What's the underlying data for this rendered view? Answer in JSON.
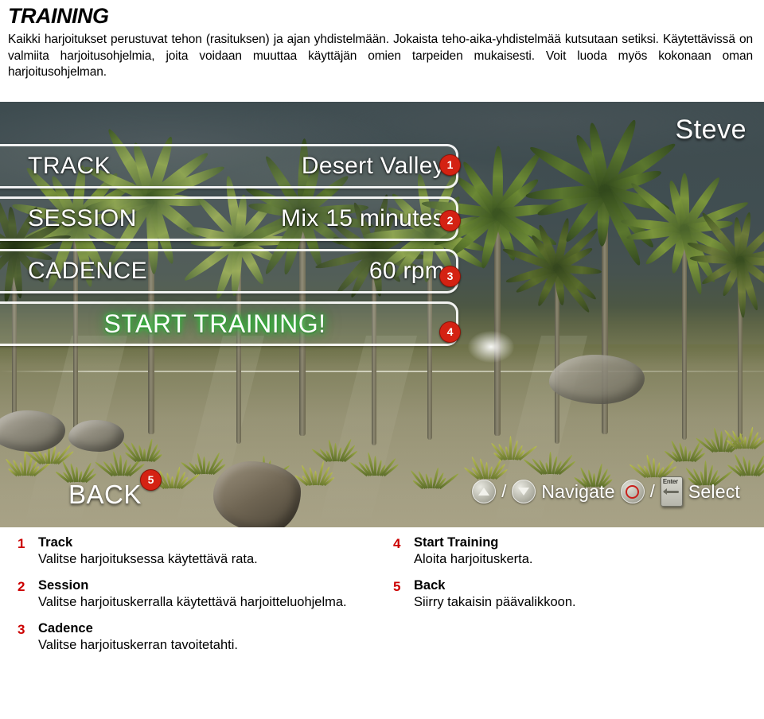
{
  "document": {
    "title": "TRAINING",
    "intro": "Kaikki harjoitukset perustuvat tehon (rasituksen) ja ajan yhdistelmään. Jokaista teho-aika-yhdistelmää kutsutaan setiksi. Käytettävissä on valmiita harjoitusohjelmia, joita voidaan muuttaa käyttäjän omien tarpeiden mukaisesti. Voit luoda myös kokonaan oman harjoitusohjelman."
  },
  "game_screen": {
    "player_name": "Steve",
    "rows": [
      {
        "label": "TRACK",
        "value": "Desert Valley",
        "badge": "1"
      },
      {
        "label": "SESSION",
        "value": "Mix 15 minutes",
        "badge": "2"
      },
      {
        "label": "CADENCE",
        "value": "60 rpm",
        "badge": "3"
      }
    ],
    "action_row": {
      "label": "START TRAINING!",
      "badge": "4"
    },
    "hud": {
      "back_label": "BACK",
      "back_badge": "5",
      "navigate_label": "Navigate",
      "select_label": "Select",
      "separator": "/",
      "enter_key_cap": "Enter"
    },
    "colors": {
      "badge_red": "#d42213",
      "start_glow_green": "#28dc3c",
      "row_outline": "#ffffff"
    }
  },
  "legend": {
    "left_column": [
      {
        "num": "1",
        "title": "Track",
        "desc": "Valitse harjoituksessa käytettävä rata."
      },
      {
        "num": "2",
        "title": "Session",
        "desc": "Valitse harjoituskerralla käytettävä harjoitteluohjelma."
      },
      {
        "num": "3",
        "title": "Cadence",
        "desc": "Valitse harjoituskerran tavoitetahti."
      }
    ],
    "right_column": [
      {
        "num": "4",
        "title": "Start Training",
        "desc": "Aloita harjoituskerta."
      },
      {
        "num": "5",
        "title": "Back",
        "desc": "Siirry takaisin päävalikkoon."
      }
    ],
    "num_color": "#cc0000"
  }
}
